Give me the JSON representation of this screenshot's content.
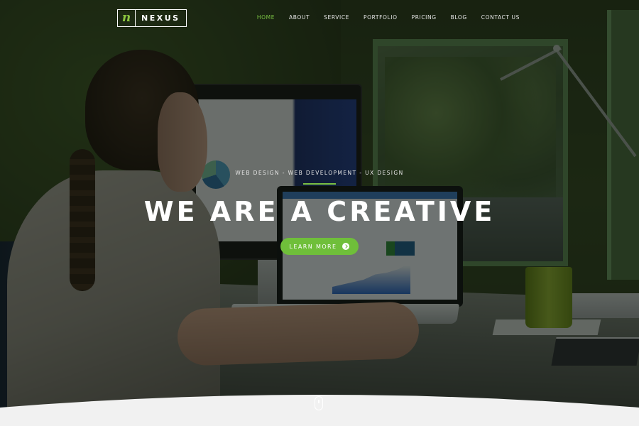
{
  "brand": {
    "mark": "n",
    "name": "NEXUS"
  },
  "nav": {
    "items": [
      {
        "label": "HOME",
        "active": true
      },
      {
        "label": "ABOUT",
        "active": false
      },
      {
        "label": "SERVICE",
        "active": false
      },
      {
        "label": "PORTFOLIO",
        "active": false
      },
      {
        "label": "PRICING",
        "active": false
      },
      {
        "label": "BLOG",
        "active": false
      },
      {
        "label": "CONTACT US",
        "active": false
      }
    ]
  },
  "hero": {
    "tagline": "WEB DESIGN - WEB DEVELOPMENT - UX DESIGN",
    "headline": "WE ARE A CREATIVE",
    "cta_label": "LEARN MORE",
    "cta_icon": "chevron-right-circle-icon",
    "scroll_icon": "mouse-scroll-icon"
  },
  "colors": {
    "accent": "#7ac143",
    "button": "#6fbf3a",
    "text": "#ffffff",
    "wave": "#f1f1f1"
  }
}
